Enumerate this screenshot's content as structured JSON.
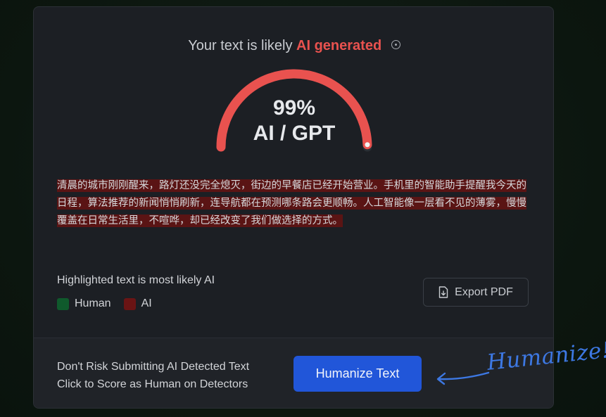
{
  "result": {
    "prefix": "Your text is likely",
    "verdict": "AI generated",
    "percent_label": "99%",
    "model_label": "AI / GPT",
    "gauge_fraction": 0.99,
    "gauge_color": "#e9524f",
    "verdict_color": "#e9524f"
  },
  "analyzed_text": "清晨的城市刚刚醒来，路灯还没完全熄灭，街边的早餐店已经开始营业。手机里的智能助手提醒我今天的日程，算法推荐的新闻悄悄刷新，连导航都在预测哪条路会更顺畅。人工智能像一层看不见的薄雾，慢慢覆盖在日常生活里，不喧哗，却已经改变了我们做选择的方式。",
  "legend": {
    "title": "Highlighted text is most likely AI",
    "human_label": "Human",
    "ai_label": "AI",
    "human_color": "#0f5a2c",
    "ai_color": "#6a1414"
  },
  "export": {
    "label": "Export PDF",
    "icon": "file-download-icon"
  },
  "footer": {
    "line1": "Don't Risk Submitting AI Detected Text",
    "line2": "Click to Score as Human on Detectors",
    "button_label": "Humanize Text"
  },
  "annotation": {
    "text": "Humanize!",
    "color": "#3d78e3"
  }
}
